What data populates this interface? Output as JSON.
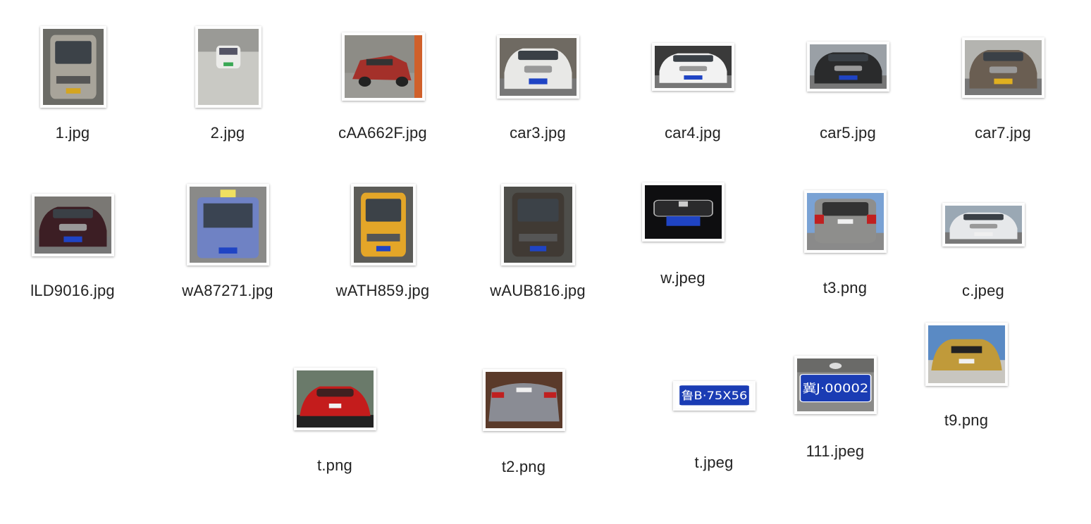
{
  "files": [
    {
      "name": "1.jpg",
      "kind": "van-front",
      "palette": {
        "bg": "#6b6b66",
        "car": "#a8a49a",
        "plate": "#d4a520"
      }
    },
    {
      "name": "2.jpg",
      "kind": "car-snow",
      "palette": {
        "bg": "#c9c9c4",
        "car": "#ececea",
        "plate": "#3aa855"
      }
    },
    {
      "name": "cAA662F.jpg",
      "kind": "sedan-side",
      "palette": {
        "bg": "#8d8c86",
        "car": "#a4302a",
        "plate": "#2a52b8"
      }
    },
    {
      "name": "car3.jpg",
      "kind": "sedan-front",
      "palette": {
        "bg": "#6f6a62",
        "car": "#e8e8e6",
        "plate": "#1f44c4"
      }
    },
    {
      "name": "car4.jpg",
      "kind": "sedan-front-wide",
      "palette": {
        "bg": "#3a3a3a",
        "car": "#f2f2f2",
        "plate": "#1f44c4"
      }
    },
    {
      "name": "car5.jpg",
      "kind": "sedan-front-wide",
      "palette": {
        "bg": "#9aa0a6",
        "car": "#2a2b2c",
        "plate": "#1f44c4"
      }
    },
    {
      "name": "car7.jpg",
      "kind": "sedan-front-wide",
      "palette": {
        "bg": "#b4b4b0",
        "car": "#6a5e52",
        "plate": "#e0b020"
      }
    },
    {
      "name": "lLD9016.jpg",
      "kind": "sedan-front-wide",
      "palette": {
        "bg": "#7a7874",
        "car": "#3c1e24",
        "plate": "#1f44c4"
      }
    },
    {
      "name": "wA87271.jpg",
      "kind": "taxi-front",
      "palette": {
        "bg": "#8a8a88",
        "car": "#6f82c4",
        "plate": "#1f44c4"
      }
    },
    {
      "name": "wATH859.jpg",
      "kind": "van-front",
      "palette": {
        "bg": "#5c5c58",
        "car": "#e4a628",
        "plate": "#1f44c4"
      }
    },
    {
      "name": "wAUB816.jpg",
      "kind": "van-front",
      "palette": {
        "bg": "#4e4e4a",
        "car": "#403a34",
        "plate": "#1f44c4"
      }
    },
    {
      "name": "w.jpeg",
      "kind": "grille-close",
      "palette": {
        "bg": "#0e0e10",
        "car": "#141416",
        "plate": "#1f44c4"
      }
    },
    {
      "name": "t3.png",
      "kind": "suv-rear",
      "palette": {
        "bg": "#7aa2d4",
        "car": "#8e8e8c",
        "plate": "#f0f0f0"
      }
    },
    {
      "name": "c.jpeg",
      "kind": "sedan-front-wide",
      "palette": {
        "bg": "#9aa8b4",
        "car": "#e6e8ea",
        "plate": "#f0f0f0"
      }
    },
    {
      "name": "t.png",
      "kind": "sports-rear",
      "palette": {
        "bg": "#6a7a6a",
        "car": "#c41c1c",
        "plate": "#f0f0f0"
      }
    },
    {
      "name": "t2.png",
      "kind": "muscle-rear",
      "palette": {
        "bg": "#5a3a2a",
        "car": "#8a8c94",
        "plate": "#f0f0f0"
      }
    },
    {
      "name": "t.jpeg",
      "kind": "plate-only",
      "palette": {
        "bg": "#ffffff",
        "car": "#ffffff",
        "plate": "#1a3cb4"
      },
      "plate_text": "鲁B·75X56"
    },
    {
      "name": "111.jpeg",
      "kind": "plate-close",
      "palette": {
        "bg": "#8a8a88",
        "car": "#6a6a68",
        "plate": "#1a3cb4"
      },
      "plate_text": "冀J·00002"
    },
    {
      "name": "t9.png",
      "kind": "muscle-front",
      "palette": {
        "bg": "#5a8ac4",
        "car": "#c09a3a",
        "plate": "#f0f0f0"
      }
    }
  ]
}
